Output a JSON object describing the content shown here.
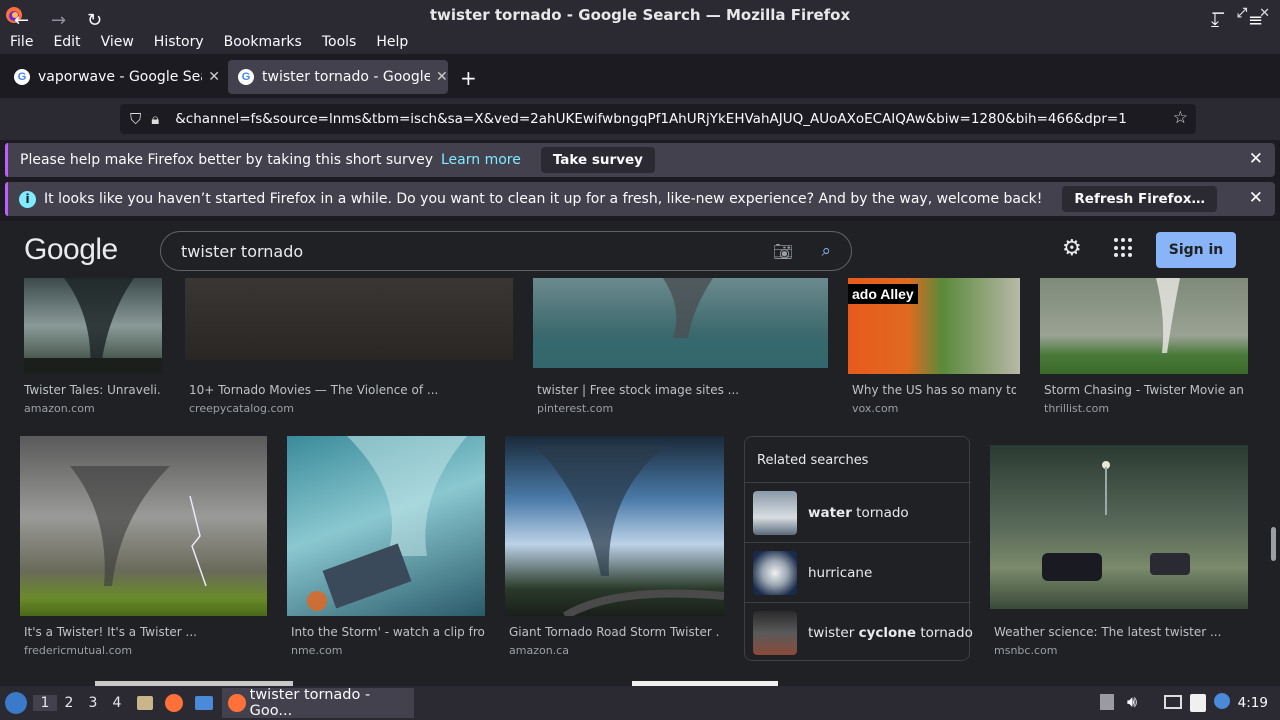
{
  "window": {
    "title": "twister tornado - Google Search — Mozilla Firefox",
    "controls": [
      "—",
      "⤢",
      "✕"
    ]
  },
  "menu": [
    "File",
    "Edit",
    "View",
    "History",
    "Bookmarks",
    "Tools",
    "Help"
  ],
  "tabs": [
    {
      "label": "vaporwave - Google Search",
      "active": false
    },
    {
      "label": "twister tornado - Google Search",
      "active": true
    }
  ],
  "url": "&channel=fs&source=lnms&tbm=isch&sa=X&ved=2ahUKEwifwbngqPf1AhURjYkEHVahAJUQ_AUoAXoECAIQAw&biw=1280&bih=466&dpr=1",
  "notifications": {
    "survey": {
      "text": "Please help make Firefox better by taking this short survey",
      "link": "Learn more",
      "button": "Take survey"
    },
    "refresh": {
      "text": "It looks like you haven’t started Firefox in a while. Do you want to clean it up for a fresh, like-new experience? And by the way, welcome back!",
      "button": "Refresh Firefox…"
    }
  },
  "google": {
    "logo": "Google",
    "query": "twister tornado",
    "signin": "Sign in"
  },
  "results_row1": [
    {
      "caption": "Twister Tales: Unraveli...",
      "source": "amazon.com"
    },
    {
      "caption": "10+ Tornado Movies — The Violence of ...",
      "source": "creepycatalog.com"
    },
    {
      "caption": "twister | Free stock image sites ...",
      "source": "pinterest.com"
    },
    {
      "caption": "Why the US has so many tor...",
      "source": "vox.com",
      "overlay": "ado Alley"
    },
    {
      "caption": "Storm Chasing - Twister Movie an...",
      "source": "thrillist.com"
    }
  ],
  "results_row2": [
    {
      "caption": "It's a Twister! It's a Twister ...",
      "source": "fredericmutual.com"
    },
    {
      "caption": "Into the Storm' - watch a clip fro...",
      "source": "nme.com"
    },
    {
      "caption": "Giant Tornado Road Storm Twister ...",
      "source": "amazon.ca"
    },
    {
      "caption": "Weather science: The latest twister ...",
      "source": "msnbc.com"
    }
  ],
  "related": {
    "title": "Related searches",
    "items": [
      {
        "bold": "water",
        "rest": " tornado"
      },
      {
        "pre": "",
        "bold": "",
        "rest": "hurricane"
      },
      {
        "pre": "twister ",
        "bold": "cyclone",
        "rest": " tornado"
      }
    ]
  },
  "taskbar": {
    "workspaces": [
      "1",
      "2",
      "3",
      "4"
    ],
    "task_label": "twister tornado - Goo...",
    "clock": "4:19"
  }
}
